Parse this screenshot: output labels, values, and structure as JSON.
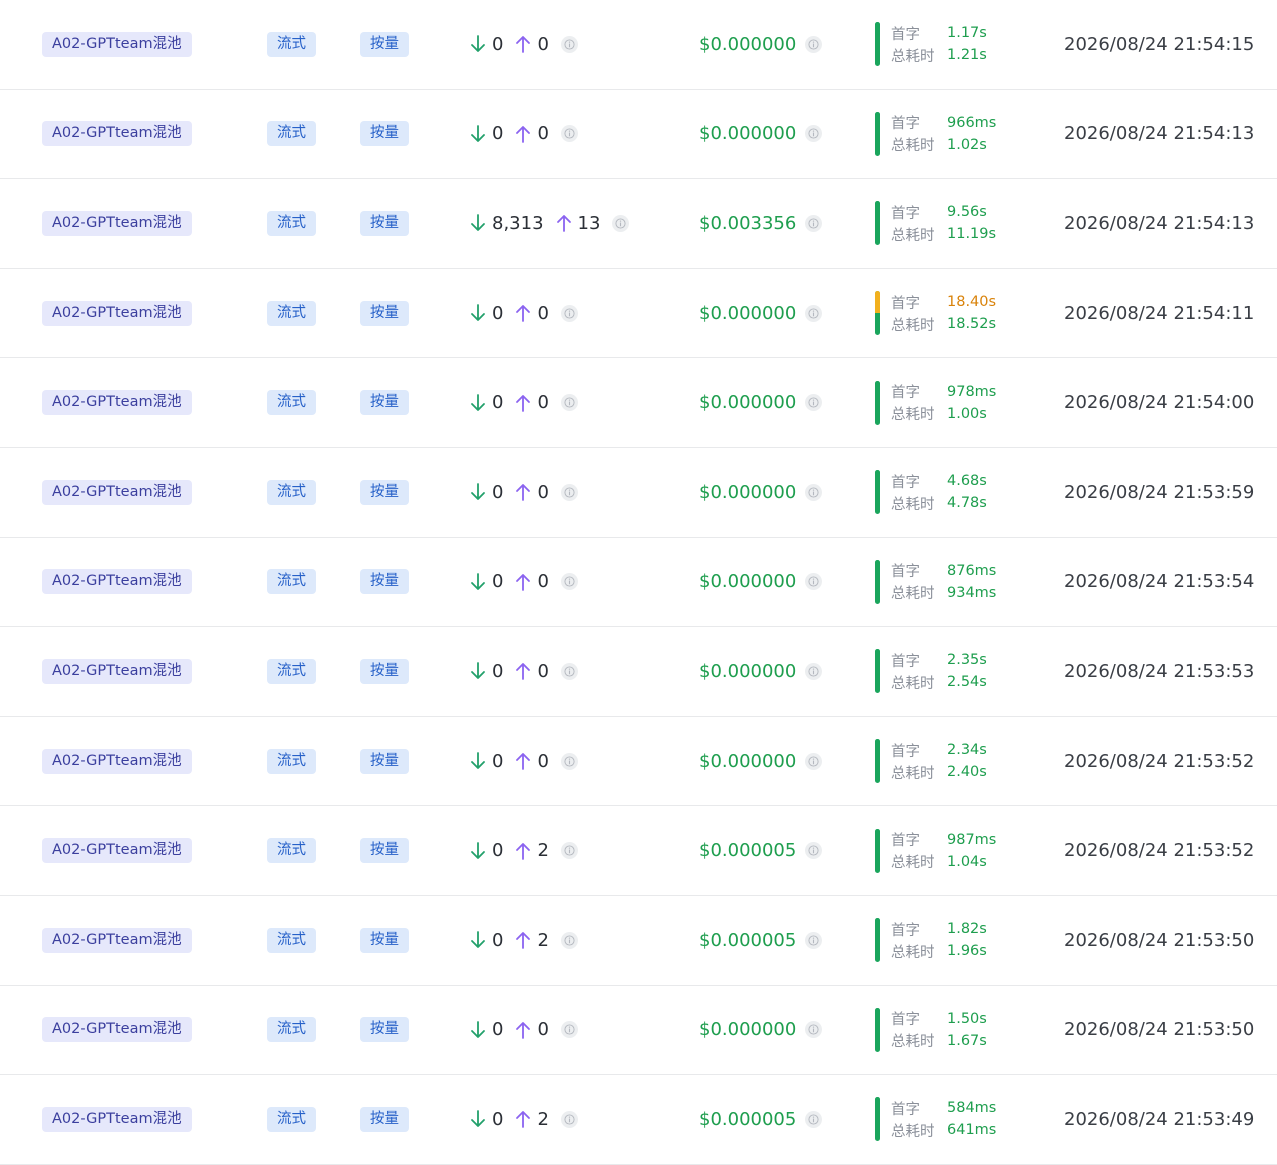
{
  "labels": {
    "first_token": "首字",
    "total_time": "总耗时"
  },
  "colors": {
    "ok": "#1aa55c",
    "warn": "#f2b01e",
    "down_arrow": "#22a06b",
    "up_arrow": "#8b63f0"
  },
  "rows": [
    {
      "pool": "A02-GPTteam混池",
      "mode": "流式",
      "billing": "按量",
      "tokens_down": "0",
      "tokens_up": "0",
      "cost": "$0.000000",
      "first_token": "1.17s",
      "first_warn": false,
      "total_time": "1.21s",
      "timestamp": "2026/08/24 21:54:15"
    },
    {
      "pool": "A02-GPTteam混池",
      "mode": "流式",
      "billing": "按量",
      "tokens_down": "0",
      "tokens_up": "0",
      "cost": "$0.000000",
      "first_token": "966ms",
      "first_warn": false,
      "total_time": "1.02s",
      "timestamp": "2026/08/24 21:54:13"
    },
    {
      "pool": "A02-GPTteam混池",
      "mode": "流式",
      "billing": "按量",
      "tokens_down": "8,313",
      "tokens_up": "13",
      "cost": "$0.003356",
      "first_token": "9.56s",
      "first_warn": false,
      "total_time": "11.19s",
      "timestamp": "2026/08/24 21:54:13"
    },
    {
      "pool": "A02-GPTteam混池",
      "mode": "流式",
      "billing": "按量",
      "tokens_down": "0",
      "tokens_up": "0",
      "cost": "$0.000000",
      "first_token": "18.40s",
      "first_warn": true,
      "total_time": "18.52s",
      "timestamp": "2026/08/24 21:54:11"
    },
    {
      "pool": "A02-GPTteam混池",
      "mode": "流式",
      "billing": "按量",
      "tokens_down": "0",
      "tokens_up": "0",
      "cost": "$0.000000",
      "first_token": "978ms",
      "first_warn": false,
      "total_time": "1.00s",
      "timestamp": "2026/08/24 21:54:00"
    },
    {
      "pool": "A02-GPTteam混池",
      "mode": "流式",
      "billing": "按量",
      "tokens_down": "0",
      "tokens_up": "0",
      "cost": "$0.000000",
      "first_token": "4.68s",
      "first_warn": false,
      "total_time": "4.78s",
      "timestamp": "2026/08/24 21:53:59"
    },
    {
      "pool": "A02-GPTteam混池",
      "mode": "流式",
      "billing": "按量",
      "tokens_down": "0",
      "tokens_up": "0",
      "cost": "$0.000000",
      "first_token": "876ms",
      "first_warn": false,
      "total_time": "934ms",
      "timestamp": "2026/08/24 21:53:54"
    },
    {
      "pool": "A02-GPTteam混池",
      "mode": "流式",
      "billing": "按量",
      "tokens_down": "0",
      "tokens_up": "0",
      "cost": "$0.000000",
      "first_token": "2.35s",
      "first_warn": false,
      "total_time": "2.54s",
      "timestamp": "2026/08/24 21:53:53"
    },
    {
      "pool": "A02-GPTteam混池",
      "mode": "流式",
      "billing": "按量",
      "tokens_down": "0",
      "tokens_up": "0",
      "cost": "$0.000000",
      "first_token": "2.34s",
      "first_warn": false,
      "total_time": "2.40s",
      "timestamp": "2026/08/24 21:53:52"
    },
    {
      "pool": "A02-GPTteam混池",
      "mode": "流式",
      "billing": "按量",
      "tokens_down": "0",
      "tokens_up": "2",
      "cost": "$0.000005",
      "first_token": "987ms",
      "first_warn": false,
      "total_time": "1.04s",
      "timestamp": "2026/08/24 21:53:52"
    },
    {
      "pool": "A02-GPTteam混池",
      "mode": "流式",
      "billing": "按量",
      "tokens_down": "0",
      "tokens_up": "2",
      "cost": "$0.000005",
      "first_token": "1.82s",
      "first_warn": false,
      "total_time": "1.96s",
      "timestamp": "2026/08/24 21:53:50"
    },
    {
      "pool": "A02-GPTteam混池",
      "mode": "流式",
      "billing": "按量",
      "tokens_down": "0",
      "tokens_up": "0",
      "cost": "$0.000000",
      "first_token": "1.50s",
      "first_warn": false,
      "total_time": "1.67s",
      "timestamp": "2026/08/24 21:53:50"
    },
    {
      "pool": "A02-GPTteam混池",
      "mode": "流式",
      "billing": "按量",
      "tokens_down": "0",
      "tokens_up": "2",
      "cost": "$0.000005",
      "first_token": "584ms",
      "first_warn": false,
      "total_time": "641ms",
      "timestamp": "2026/08/24 21:53:49"
    }
  ]
}
